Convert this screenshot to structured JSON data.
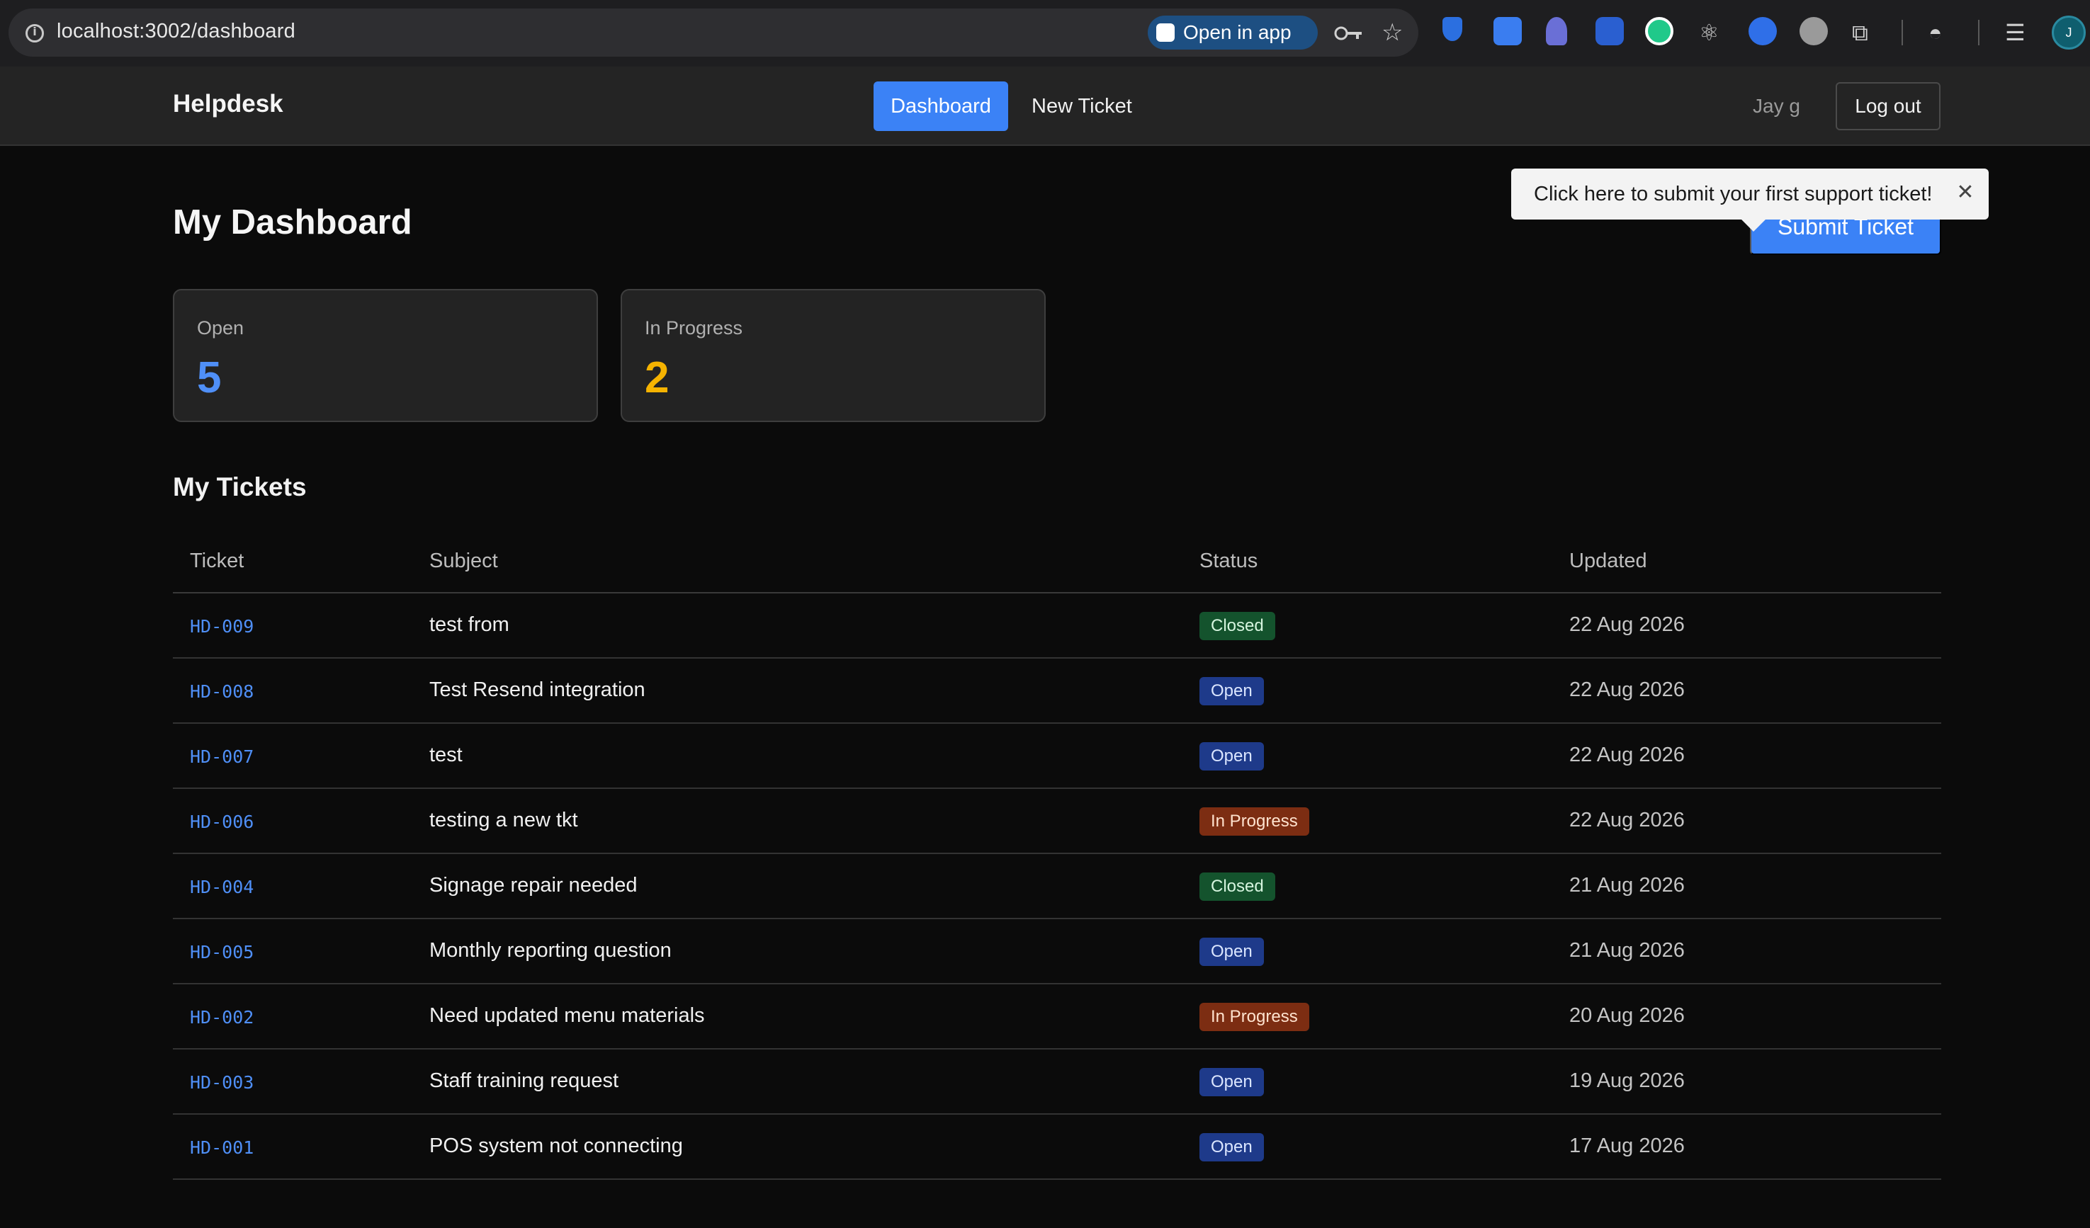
{
  "browser": {
    "url": "localhost:3002/dashboard",
    "open_in_app_label": "Open in app",
    "profile_initial": "J",
    "extension_icons": [
      "sapphire-icon",
      "snowflake-icon",
      "flame-icon",
      "drink-icon",
      "green-circle-icon",
      "react-icon",
      "blue-circle-icon",
      "avatar-icon",
      "puzzle-icon"
    ]
  },
  "navbar": {
    "brand": "Helpdesk",
    "links": {
      "dashboard": "Dashboard",
      "new_ticket": "New Ticket"
    },
    "user_name": "Jay g",
    "logout_label": "Log out"
  },
  "main": {
    "title": "My Dashboard",
    "submit_label": "Submit Ticket",
    "tooltip": "Click here to submit your first support ticket!",
    "stats": [
      {
        "label": "Open",
        "value": "5",
        "color": "#4f8ff7"
      },
      {
        "label": "In Progress",
        "value": "2",
        "color": "#f5b301"
      }
    ],
    "tickets_title": "My Tickets",
    "columns": [
      "Ticket",
      "Subject",
      "Status",
      "Updated"
    ],
    "tickets": [
      {
        "id": "HD-009",
        "subject": "test from",
        "status": "Closed",
        "updated": "22 Aug 2026"
      },
      {
        "id": "HD-008",
        "subject": "Test Resend integration",
        "status": "Open",
        "updated": "22 Aug 2026"
      },
      {
        "id": "HD-007",
        "subject": "test",
        "status": "Open",
        "updated": "22 Aug 2026"
      },
      {
        "id": "HD-006",
        "subject": "testing a new tkt",
        "status": "In Progress",
        "updated": "22 Aug 2026"
      },
      {
        "id": "HD-004",
        "subject": "Signage repair needed",
        "status": "Closed",
        "updated": "21 Aug 2026"
      },
      {
        "id": "HD-005",
        "subject": "Monthly reporting question",
        "status": "Open",
        "updated": "21 Aug 2026"
      },
      {
        "id": "HD-002",
        "subject": "Need updated menu materials",
        "status": "In Progress",
        "updated": "20 Aug 2026"
      },
      {
        "id": "HD-003",
        "subject": "Staff training request",
        "status": "Open",
        "updated": "19 Aug 2026"
      },
      {
        "id": "HD-001",
        "subject": "POS system not connecting",
        "status": "Open",
        "updated": "17 Aug 2026"
      }
    ],
    "status_colors": {
      "Open": {
        "bg": "#1e3a8a",
        "fg": "#dbe6ff"
      },
      "Closed": {
        "bg": "#14532d",
        "fg": "#d6f5df"
      },
      "In Progress": {
        "bg": "#7c2d12",
        "fg": "#ffe3cf"
      }
    }
  }
}
